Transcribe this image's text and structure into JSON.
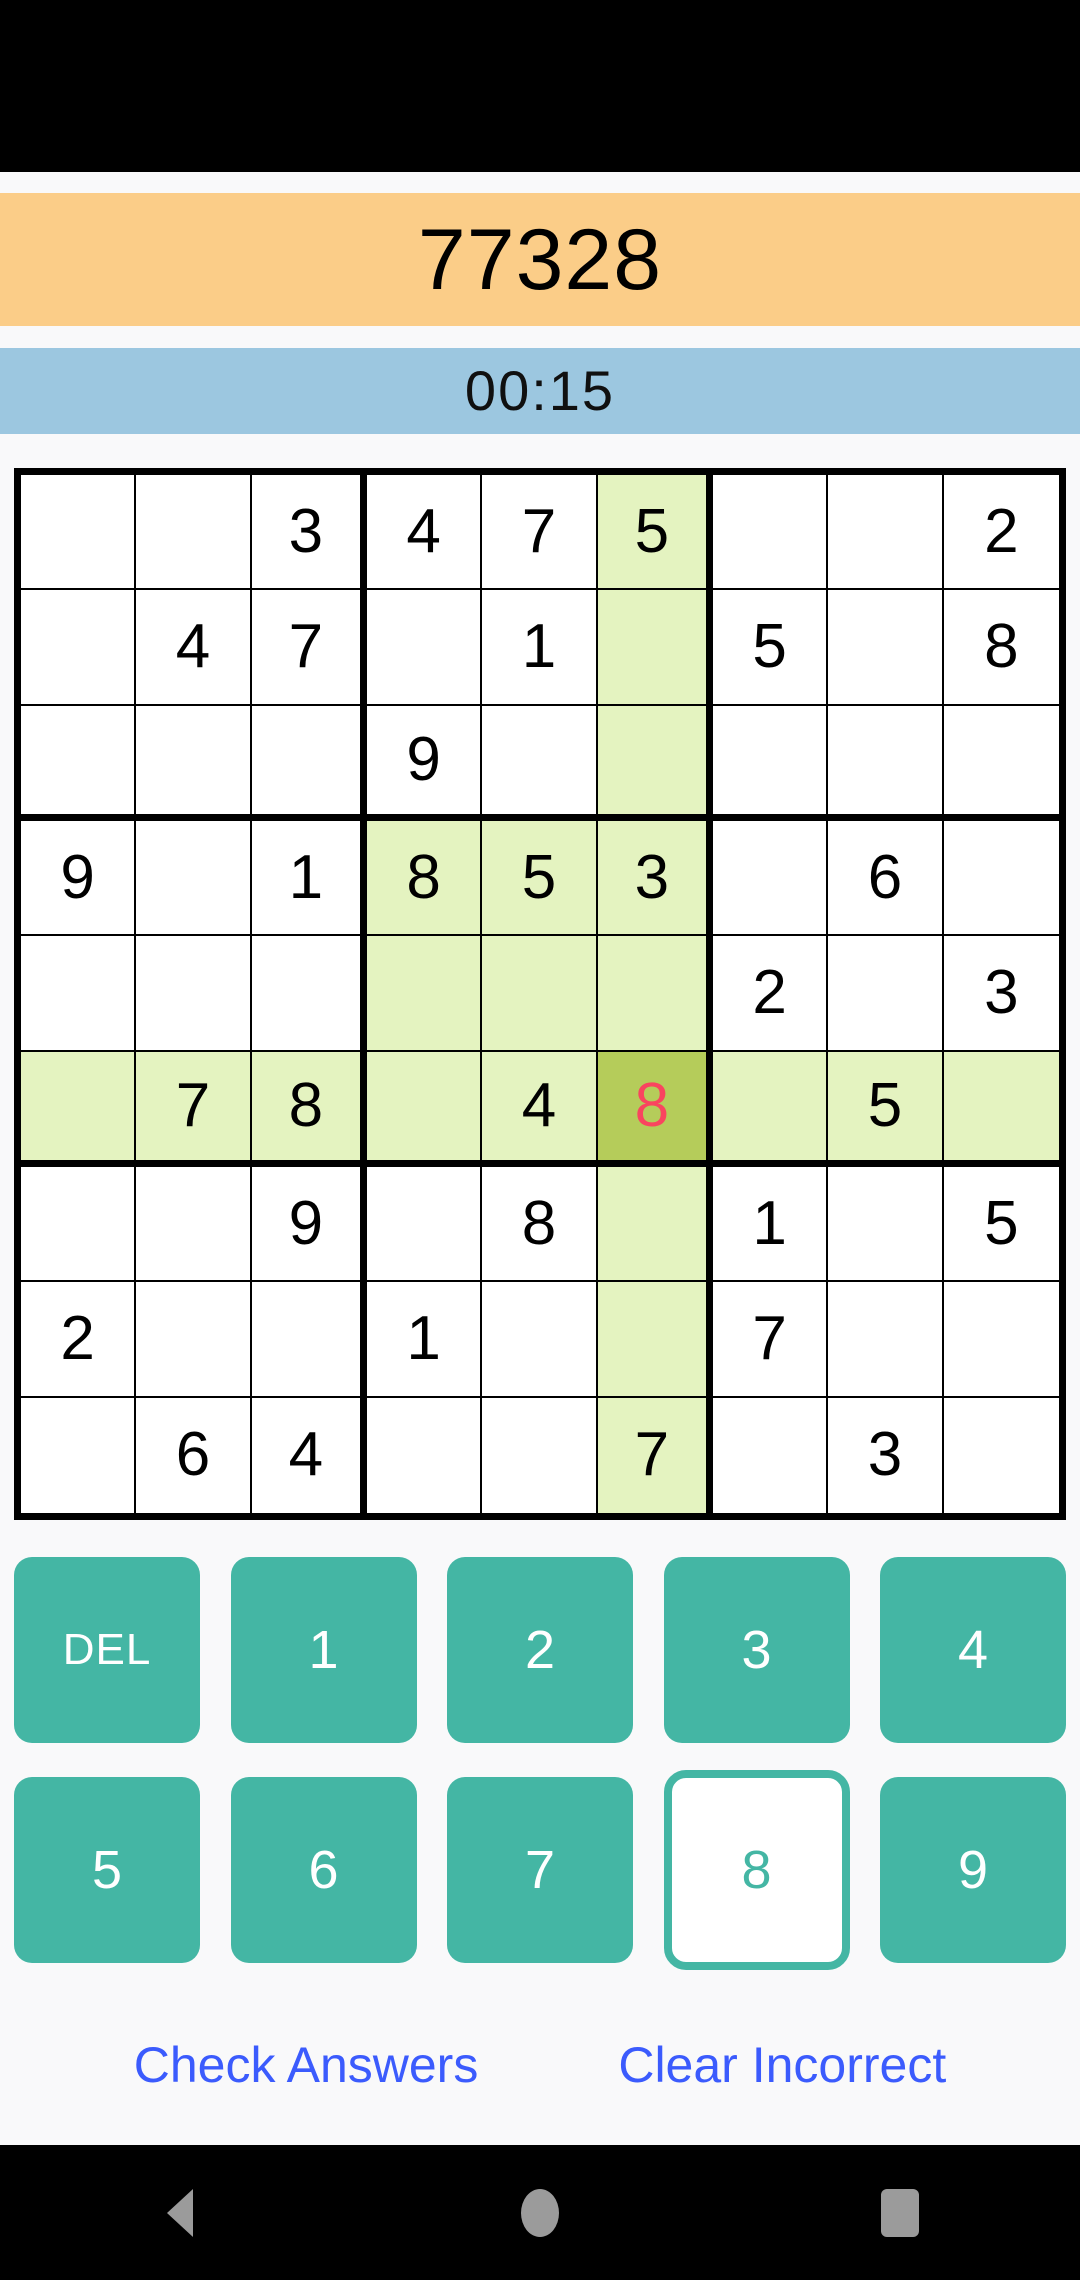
{
  "app": {
    "title": "77328",
    "timer": "00:15"
  },
  "colors": {
    "title_bar": "#fbcd88",
    "timer_bar": "#9cc7e0",
    "highlight": "#e4f3c0",
    "selected": "#b5cc5a",
    "wrong_value": "#f9455f",
    "key": "#44b6a4",
    "link": "#3b5bfd",
    "page_bg": "#f9f9fa"
  },
  "board": {
    "rows": [
      [
        "",
        "",
        "3",
        "4",
        "7",
        "5",
        "",
        "",
        "2"
      ],
      [
        "",
        "4",
        "7",
        "",
        "1",
        "",
        "5",
        "",
        "8"
      ],
      [
        "",
        "",
        "",
        "9",
        "",
        "",
        "",
        "",
        ""
      ],
      [
        "9",
        "",
        "1",
        "8",
        "5",
        "3",
        "",
        "6",
        ""
      ],
      [
        "",
        "",
        "",
        "",
        "",
        "",
        "2",
        "",
        "3"
      ],
      [
        "",
        "7",
        "8",
        "",
        "4",
        "8",
        "",
        "5",
        ""
      ],
      [
        "",
        "",
        "9",
        "",
        "8",
        "",
        "1",
        "",
        "5"
      ],
      [
        "2",
        "",
        "",
        "1",
        "",
        "",
        "7",
        "",
        ""
      ],
      [
        "",
        "6",
        "4",
        "",
        "",
        "7",
        "",
        "3",
        ""
      ]
    ],
    "selected_cell": {
      "row": 6,
      "col": 6
    },
    "wrong_cells": [
      {
        "row": 6,
        "col": 6
      }
    ],
    "highlight_row": 6,
    "highlight_col": 6,
    "highlight_box": {
      "row_start": 4,
      "row_end": 6,
      "col_start": 4,
      "col_end": 6
    }
  },
  "keypad": {
    "rows": [
      [
        {
          "label": "DEL",
          "active": false
        },
        {
          "label": "1",
          "active": false
        },
        {
          "label": "2",
          "active": false
        },
        {
          "label": "3",
          "active": false
        },
        {
          "label": "4",
          "active": false
        }
      ],
      [
        {
          "label": "5",
          "active": false
        },
        {
          "label": "6",
          "active": false
        },
        {
          "label": "7",
          "active": false
        },
        {
          "label": "8",
          "active": true
        },
        {
          "label": "9",
          "active": false
        }
      ]
    ]
  },
  "actions": {
    "check": "Check Answers",
    "clear": "Clear Incorrect"
  },
  "navbar": {
    "back": "back-icon",
    "home": "home-icon",
    "recents": "recents-icon"
  }
}
